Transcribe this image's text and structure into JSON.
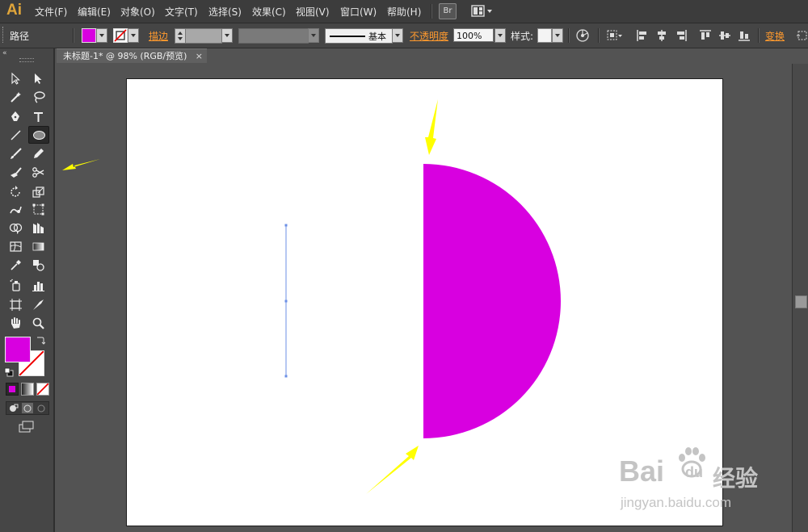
{
  "app": {
    "logo": "Ai"
  },
  "menu": {
    "items": [
      "文件(F)",
      "编辑(E)",
      "对象(O)",
      "文字(T)",
      "选择(S)",
      "效果(C)",
      "视图(V)",
      "窗口(W)",
      "帮助(H)"
    ],
    "bridge_badge": "Br"
  },
  "control_bar": {
    "selection_label": "路径",
    "stroke_label": "描边",
    "brush_style": "基本",
    "opacity_label": "不透明度",
    "opacity_value": "100%",
    "style_label": "样式:",
    "transform_label": "变换"
  },
  "document": {
    "tab_title": "未标题-1* @ 98% (RGB/预览)",
    "tab_close": "×"
  },
  "colors": {
    "fill": "#d800e0",
    "shape_fill": "#d800e0",
    "path_line": "#6b8fe6",
    "arrow": "#ffff00",
    "accent_orange": "#ff9a2e"
  },
  "toolbar": {
    "tools": [
      "selection-tool",
      "direct-selection-tool",
      "magic-wand-tool",
      "lasso-tool",
      "pen-tool",
      "type-tool",
      "line-segment-tool",
      "ellipse-tool",
      "paintbrush-tool",
      "pencil-tool",
      "blob-brush-tool",
      "scissors-tool",
      "rotate-tool",
      "scale-tool",
      "warp-tool",
      "free-transform-tool",
      "shape-builder-tool",
      "perspective-grid-tool",
      "mesh-tool",
      "gradient-tool",
      "eyedropper-tool",
      "blend-tool",
      "symbol-sprayer-tool",
      "column-graph-tool",
      "artboard-tool",
      "slice-tool",
      "hand-tool",
      "zoom-tool"
    ],
    "active_tool": "ellipse-tool"
  },
  "watermark": {
    "brand": "Bai",
    "brand2": "du",
    "cn": "经验",
    "url": "jingyan.baidu.com"
  }
}
